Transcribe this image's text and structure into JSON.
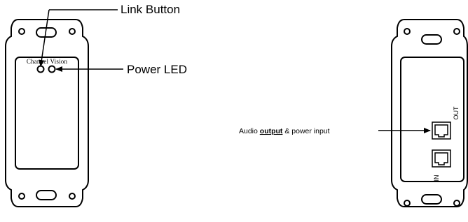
{
  "front_panel": {
    "brand": "Channel Vision",
    "callouts": {
      "link_button": "Link Button",
      "power_led": "Power LED"
    }
  },
  "rear_panel": {
    "port_labels": {
      "out": "OUT",
      "in": "IN"
    },
    "callout": {
      "prefix": "Audio ",
      "emphasis": "output",
      "suffix": " & power input"
    }
  },
  "colors": {
    "ink": "#000000",
    "background": "#ffffff"
  }
}
